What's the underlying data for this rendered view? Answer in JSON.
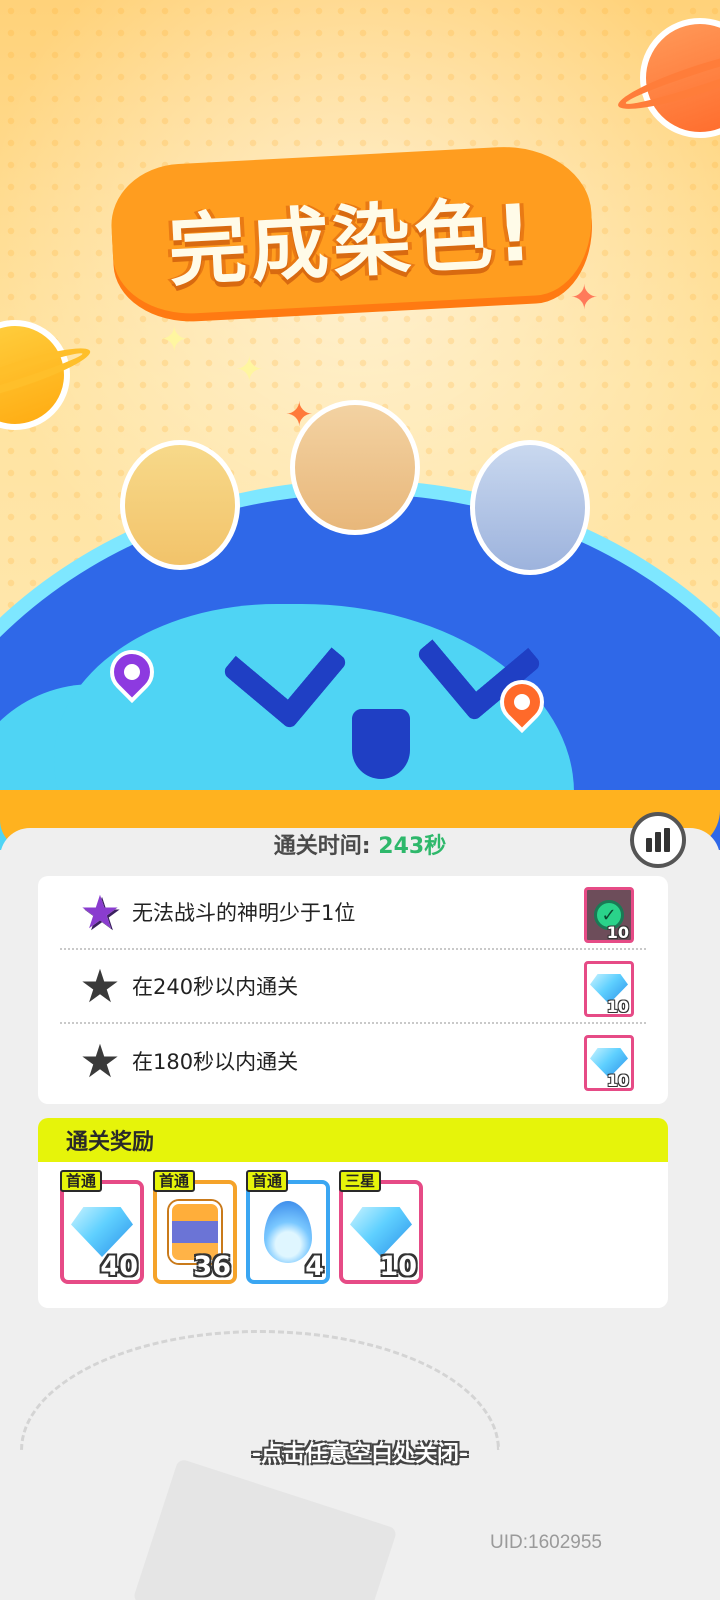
{
  "title": "完成染色!",
  "clear_time": {
    "label": "通关时间:",
    "value": "243秒"
  },
  "objectives": [
    {
      "text": "无法战斗的神明少于1位",
      "completed": true,
      "reward_icon": "check-icon",
      "reward_count": "10"
    },
    {
      "text": "在240秒以内通关",
      "completed": false,
      "reward_icon": "gem-icon",
      "reward_count": "10"
    },
    {
      "text": "在180秒以内通关",
      "completed": false,
      "reward_icon": "gem-icon",
      "reward_count": "10"
    }
  ],
  "rewards": {
    "header": "通关奖励",
    "items": [
      {
        "tag": "首通",
        "icon": "gem-icon",
        "count": "40",
        "border": "#e64b86"
      },
      {
        "tag": "首通",
        "icon": "dye-jar-icon",
        "count": "36",
        "border": "#f5a32a"
      },
      {
        "tag": "首通",
        "icon": "blue-flame-icon",
        "count": "4",
        "border": "#3aa6f2"
      },
      {
        "tag": "三星",
        "icon": "gem-icon",
        "count": "10",
        "border": "#e64b86"
      }
    ]
  },
  "close_hint": "-点击任意空白处关闭-",
  "uid": "UID:1602955",
  "colors": {
    "accent_yellow": "#e6f40a",
    "time_green": "#2eb86b",
    "reward_pink": "#e64b86"
  }
}
